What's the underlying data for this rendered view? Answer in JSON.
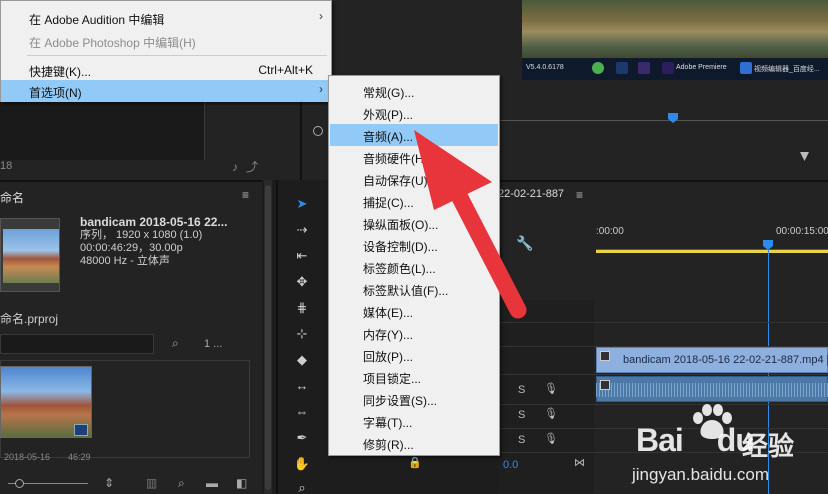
{
  "colors": {
    "highlight": "#91c9f7",
    "accent_blue": "#2d8ceb",
    "arrow_red": "#e8343b",
    "timeline_yellow": "#e8d34a"
  },
  "menu1": {
    "items": [
      {
        "label": "在 Adobe Audition 中编辑",
        "shortcut": "",
        "has_submenu": true,
        "disabled": false,
        "highlighted": false
      },
      {
        "label": "在 Adobe Photoshop 中编辑(H)",
        "shortcut": "",
        "has_submenu": false,
        "disabled": true,
        "highlighted": false
      },
      {
        "label": "快捷键(K)...",
        "shortcut": "Ctrl+Alt+K",
        "has_submenu": false,
        "disabled": false,
        "highlighted": false
      },
      {
        "label": "首选项(N)",
        "shortcut": "",
        "has_submenu": true,
        "disabled": false,
        "highlighted": true
      }
    ]
  },
  "submenu": {
    "items": [
      "常规(G)...",
      "外观(P)...",
      "音频(A)...",
      "音频硬件(H)...",
      "自动保存(U)...",
      "捕捉(C)...",
      "操纵面板(O)...",
      "设备控制(D)...",
      "标签颜色(L)...",
      "标签默认值(F)...",
      "媒体(E)...",
      "内存(Y)...",
      "回放(P)...",
      "项目锁定...",
      "同步设置(S)...",
      "字幕(T)...",
      "修剪(R)..."
    ],
    "highlighted_index": 2
  },
  "taskbar": {
    "version": "V5.4.0.6178",
    "premiere": "Adobe Premiere",
    "editor": "视频编辑器_百度经..."
  },
  "top_left": {
    "number": "18"
  },
  "project": {
    "title": "命名",
    "clip_name": "bandicam 2018-05-16 22...",
    "clip_type": "序列，  1920 x 1080 (1.0)",
    "clip_duration": "00:00:46:29，30.00p",
    "clip_audio": "48000 Hz - 立体声",
    "file_name": "命名.prproj",
    "count": "1 ...",
    "thumb_caption_left": "2018-05-16 ",
    "thumb_caption_right": "46:29"
  },
  "timeline": {
    "sequence_name": "22-02-21-887",
    "tc_start": ":00:00",
    "tc_end": "00:00:15:00",
    "clip_name": "bandicam 2018-05-16 22-02-21-887.mp4 [",
    "current_time": "0.0",
    "audio_rows": [
      "S",
      "S",
      "S"
    ]
  },
  "watermark": {
    "brand": "Bai",
    "brand_mid": "du",
    "cn": "经验",
    "url": "jingyan.baidu.com"
  }
}
